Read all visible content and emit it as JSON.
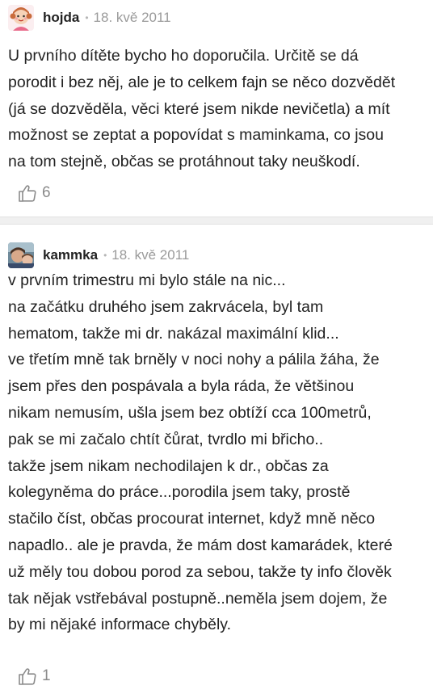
{
  "posts": [
    {
      "username": "hojda",
      "date": "18. kvě 2011",
      "text": "U prvního dítěte bycho ho doporučila. Určitě se dá\nporodit i bez něj, ale je to celkem fajn se něco dozvědět\n(já se dozvěděla, věci které jsem nikde nevičetla) a mít\nmožnost se zeptat a popovídat s maminkama, co jsou\nna tom stejně, občas se protáhnout taky neuškodí.",
      "likes": "6",
      "avatar_icon": "cartoon-girl-avatar-icon"
    },
    {
      "username": "kammka",
      "date": "18. kvě 2011",
      "text": "v prvním trimestru mi bylo stále na nic...\nna začátku druhého jsem zakrvácela, byl tam\nhematom, takže mi dr. nakázal maximální klid...\nve třetím mně tak brněly v noci nohy a pálila žáha, že\njsem přes den pospávala a byla ráda, že většinou\nnikam nemusím, ušla jsem bez obtíží cca 100metrů,\npak se mi začalo chtít čůrat, tvrdlo mi břicho..\ntakže jsem nikam nechodilajen k dr., občas za\nkolegyněma do práce...porodila jsem taky, prostě\nstačilo číst, občas procourat internet, když mně něco\nnapadlo.. ale je pravda, že mám dost kamarádek, které\nuž měly tou dobou porod za sebou, takže ty info člověk\ntak nějak vstřebával postupně..neměla jsem dojem, že\nby mi nějaké informace chyběly.",
      "likes": "1",
      "avatar_icon": "photo-avatar-icon"
    }
  ],
  "separator_dot": "•",
  "colors": {
    "text": "#222222",
    "meta": "#9a9a9a",
    "separator": "#f0f0f0"
  },
  "like_icon": "thumbs-up-icon"
}
